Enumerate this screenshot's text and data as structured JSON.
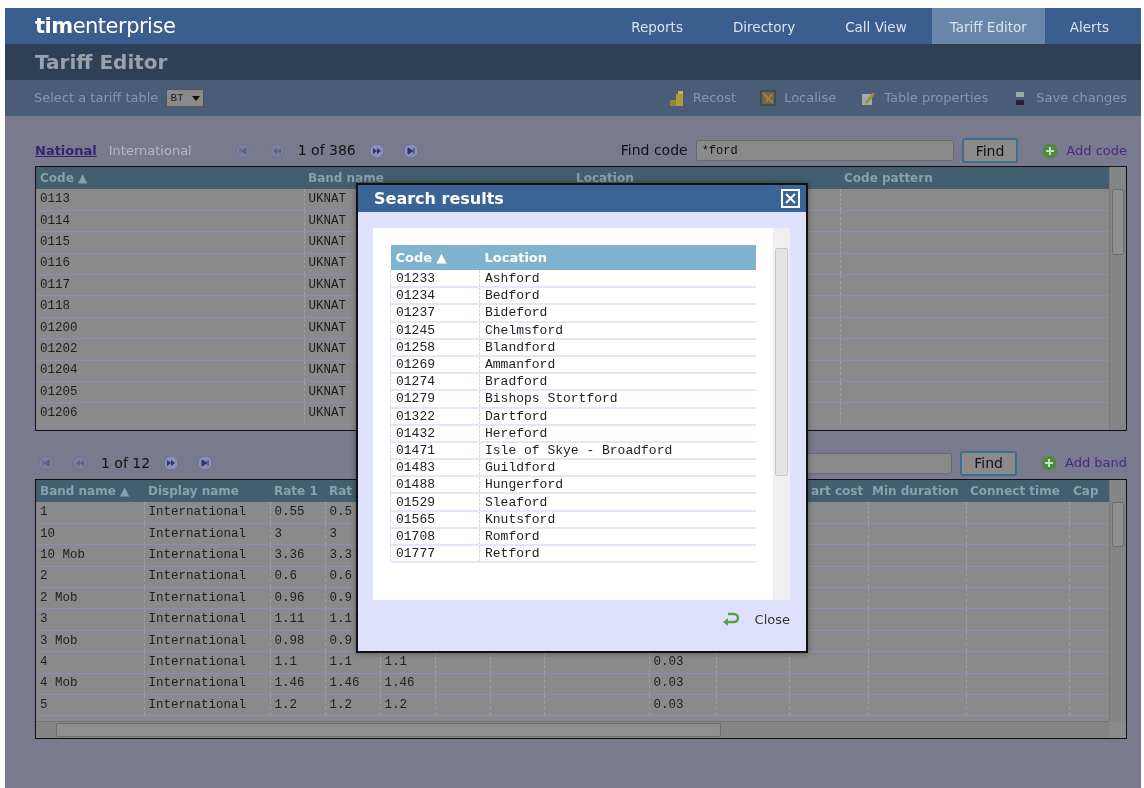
{
  "app": {
    "logo": "**tim**enterprise"
  },
  "nav": [
    {
      "label": "Reports",
      "selected": false
    },
    {
      "label": "Directory",
      "selected": false
    },
    {
      "label": "Call View",
      "selected": false
    },
    {
      "label": "Tariff Editor",
      "selected": true
    },
    {
      "label": "Alerts",
      "selected": false
    }
  ],
  "page_title": "Tariff Editor",
  "toolbar": {
    "table_label": "Select a tariff table",
    "table_select": "BT",
    "actions": [
      "Recost",
      "Localise",
      "Table properties",
      "Save changes"
    ]
  },
  "codes_section": {
    "tabs": [
      {
        "label": "National",
        "selected": true
      },
      {
        "label": "International",
        "selected": false
      }
    ],
    "pager": "1 of 386",
    "find_label": "Find code",
    "find_value": "*ford",
    "find_button": "Find",
    "add_label": "Add code",
    "table": {
      "columns": [
        "Code ▲",
        "Band name",
        "Location",
        "Code pattern"
      ],
      "rows": [
        [
          "0113",
          "UKNAT",
          null,
          null
        ],
        [
          "0114",
          "UKNAT",
          null,
          null
        ],
        [
          "0115",
          "UKNAT",
          null,
          null
        ],
        [
          "0116",
          "UKNAT",
          null,
          null
        ],
        [
          "0117",
          "UKNAT",
          null,
          null
        ],
        [
          "0118",
          "UKNAT",
          null,
          null
        ],
        [
          "01200",
          "UKNAT",
          null,
          null
        ],
        [
          "01202",
          "UKNAT",
          null,
          null
        ],
        [
          "01204",
          "UKNAT",
          null,
          null
        ],
        [
          "01205",
          "UKNAT",
          null,
          null
        ],
        [
          "01206",
          "UKNAT",
          null,
          null
        ]
      ]
    }
  },
  "bands_section": {
    "pager": "1 of 12",
    "find_button": "Find",
    "add_label": "Add band",
    "table": {
      "columns": [
        "Band name ▲",
        "Display name",
        "Rate 1",
        "Rat",
        null,
        null,
        null,
        null,
        null,
        null,
        "art cost",
        "Min duration",
        "Connect time",
        "Cap"
      ],
      "rows": [
        [
          "1",
          "International",
          "0.55",
          "0.5",
          null,
          null,
          null,
          null,
          null,
          null,
          null,
          null,
          null,
          null
        ],
        [
          "10",
          "International",
          "3",
          "3",
          null,
          null,
          null,
          null,
          null,
          null,
          null,
          null,
          null,
          null
        ],
        [
          "10 Mob",
          "International",
          "3.36",
          "3.3",
          null,
          null,
          null,
          null,
          null,
          null,
          null,
          null,
          null,
          null
        ],
        [
          "2",
          "International",
          "0.6",
          "0.6",
          null,
          null,
          null,
          null,
          null,
          null,
          null,
          null,
          null,
          null
        ],
        [
          "2 Mob",
          "International",
          "0.96",
          "0.9",
          null,
          null,
          null,
          null,
          null,
          null,
          null,
          null,
          null,
          null
        ],
        [
          "3",
          "International",
          "1.11",
          "1.1",
          null,
          null,
          null,
          null,
          null,
          null,
          null,
          null,
          null,
          null
        ],
        [
          "3 Mob",
          "International",
          "0.98",
          "0.9",
          null,
          null,
          null,
          null,
          null,
          null,
          null,
          null,
          null,
          null
        ],
        [
          "4",
          "International",
          "1.1",
          "1.1",
          "1.1",
          null,
          null,
          null,
          "0.03",
          null,
          null,
          null,
          null,
          null
        ],
        [
          "4 Mob",
          "International",
          "1.46",
          "1.46",
          "1.46",
          null,
          null,
          null,
          "0.03",
          null,
          null,
          null,
          null,
          null
        ],
        [
          "5",
          "International",
          "1.2",
          "1.2",
          "1.2",
          null,
          null,
          null,
          "0.03",
          null,
          null,
          null,
          null,
          null
        ]
      ]
    }
  },
  "search_dialog": {
    "title": "Search results",
    "columns": [
      "Code ▲",
      "Location"
    ],
    "rows": [
      [
        "01233",
        "Ashford"
      ],
      [
        "01234",
        "Bedford"
      ],
      [
        "01237",
        "Bideford"
      ],
      [
        "01245",
        "Chelmsford"
      ],
      [
        "01258",
        "Blandford"
      ],
      [
        "01269",
        "Ammanford"
      ],
      [
        "01274",
        "Bradford"
      ],
      [
        "01279",
        "Bishops Stortford"
      ],
      [
        "01322",
        "Dartford"
      ],
      [
        "01432",
        "Hereford"
      ],
      [
        "01471",
        "Isle of Skye - Broadford"
      ],
      [
        "01483",
        "Guildford"
      ],
      [
        "01488",
        "Hungerford"
      ],
      [
        "01529",
        "Sleaford"
      ],
      [
        "01565",
        "Knutsford"
      ],
      [
        "01708",
        "Romford"
      ],
      [
        "01777",
        "Retford"
      ]
    ],
    "close_label": "Close"
  }
}
